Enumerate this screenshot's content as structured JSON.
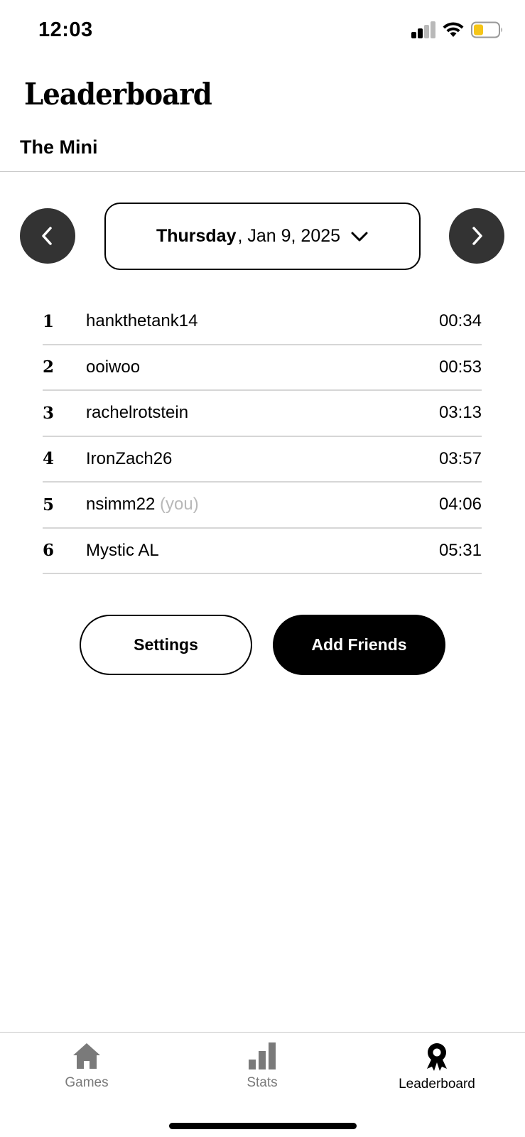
{
  "status_bar": {
    "time": "12:03",
    "icons": [
      "cellular-signal-icon",
      "wifi-icon",
      "battery-icon"
    ],
    "battery_color": "#f5c518"
  },
  "header": {
    "title": "Leaderboard",
    "subtitle": "The Mini"
  },
  "date_selector": {
    "day": "Thursday",
    "date": ", Jan 9, 2025",
    "prev_icon": "chevron-left-icon",
    "next_icon": "chevron-right-icon",
    "dropdown_icon": "chevron-down-icon"
  },
  "leaderboard": {
    "rows": [
      {
        "rank": "1",
        "name": "hankthetank14",
        "suffix": "",
        "time": "00:34"
      },
      {
        "rank": "2",
        "name": "ooiwoo",
        "suffix": "",
        "time": "00:53"
      },
      {
        "rank": "3",
        "name": "rachelrotstein",
        "suffix": "",
        "time": "03:13"
      },
      {
        "rank": "4",
        "name": "IronZach26",
        "suffix": "",
        "time": "03:57"
      },
      {
        "rank": "5",
        "name": "nsimm22",
        "suffix": " (you)",
        "time": "04:06"
      },
      {
        "rank": "6",
        "name": "Mystic AL",
        "suffix": "",
        "time": "05:31"
      }
    ]
  },
  "actions": {
    "settings_label": "Settings",
    "add_friends_label": "Add Friends"
  },
  "tab_bar": {
    "tabs": [
      {
        "label": "Games",
        "icon": "home-icon",
        "active": false
      },
      {
        "label": "Stats",
        "icon": "bar-chart-icon",
        "active": false
      },
      {
        "label": "Leaderboard",
        "icon": "award-ribbon-icon",
        "active": true
      }
    ]
  },
  "colors": {
    "nav_button": "#333333",
    "inactive_tab": "#7a7a7a",
    "divider": "#d6d6d6",
    "you_label": "#b8b8b8"
  }
}
